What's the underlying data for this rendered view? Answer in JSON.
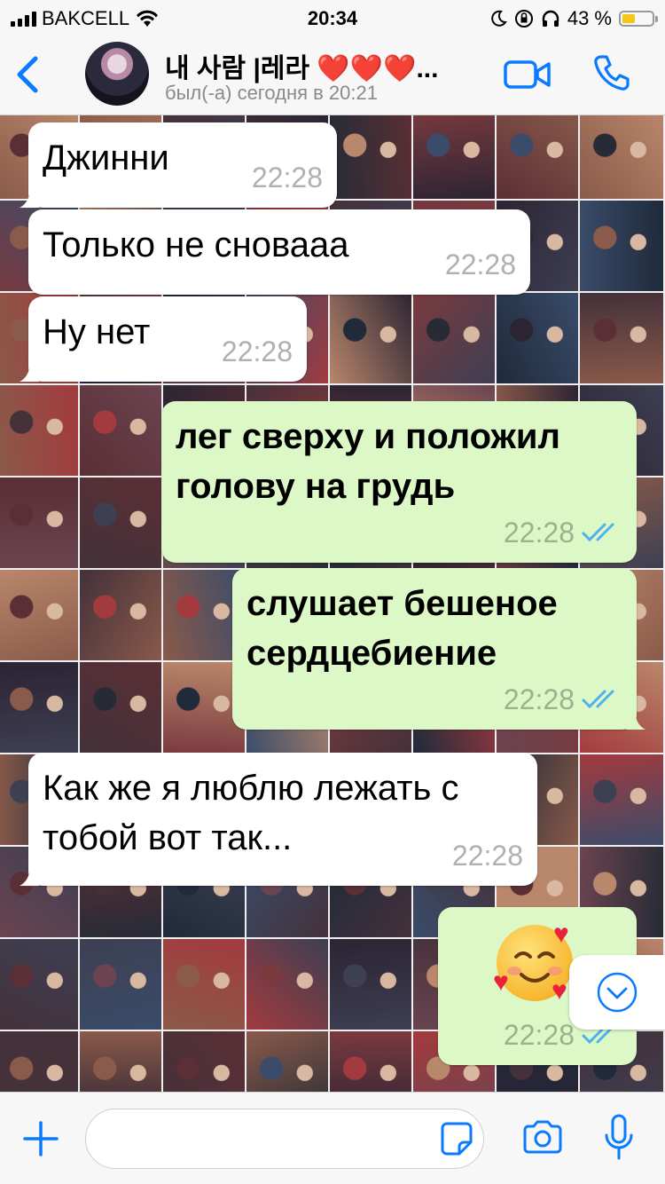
{
  "status_bar": {
    "carrier": "BAKCELL",
    "time": "20:34",
    "battery_percent": "43 %",
    "battery_level": 0.43,
    "icons": [
      "signal-icon",
      "wifi-icon",
      "moon-icon",
      "orientation-lock-icon",
      "headphones-icon",
      "battery-icon"
    ]
  },
  "header": {
    "contact_name": "내 사람 |레라 ❤️❤️❤️...",
    "status": "был(-а) сегодня в 20:21",
    "icons": [
      "back-icon",
      "video-call-icon",
      "phone-call-icon"
    ]
  },
  "messages": [
    {
      "direction": "in",
      "text": "Джинни",
      "time": "22:28"
    },
    {
      "direction": "in",
      "text": "Только не сноваaa",
      "time": "22:28"
    },
    {
      "direction": "in",
      "text": "Ну нет",
      "time": "22:28"
    },
    {
      "direction": "out",
      "text": "лег сверху и положил голову на грудь",
      "time": "22:28",
      "read": true
    },
    {
      "direction": "out",
      "text": "слушает бешеное сердцебиение",
      "time": "22:28",
      "read": true
    },
    {
      "direction": "in",
      "text": "Как же я люблю лежать с тобой вот так...",
      "time": "22:28"
    },
    {
      "direction": "out",
      "emoji": "smiling-face-with-hearts",
      "time": "22:28",
      "read": true
    }
  ],
  "input": {
    "placeholder": "",
    "icons": [
      "plus-icon",
      "sticker-icon",
      "camera-icon",
      "microphone-icon"
    ]
  },
  "colors": {
    "accent": "#0a7aff",
    "incoming_bubble": "#ffffff",
    "outgoing_bubble": "#dcf8c6",
    "read_ticks": "#4fb0f0",
    "battery_fill": "#f5c518"
  }
}
